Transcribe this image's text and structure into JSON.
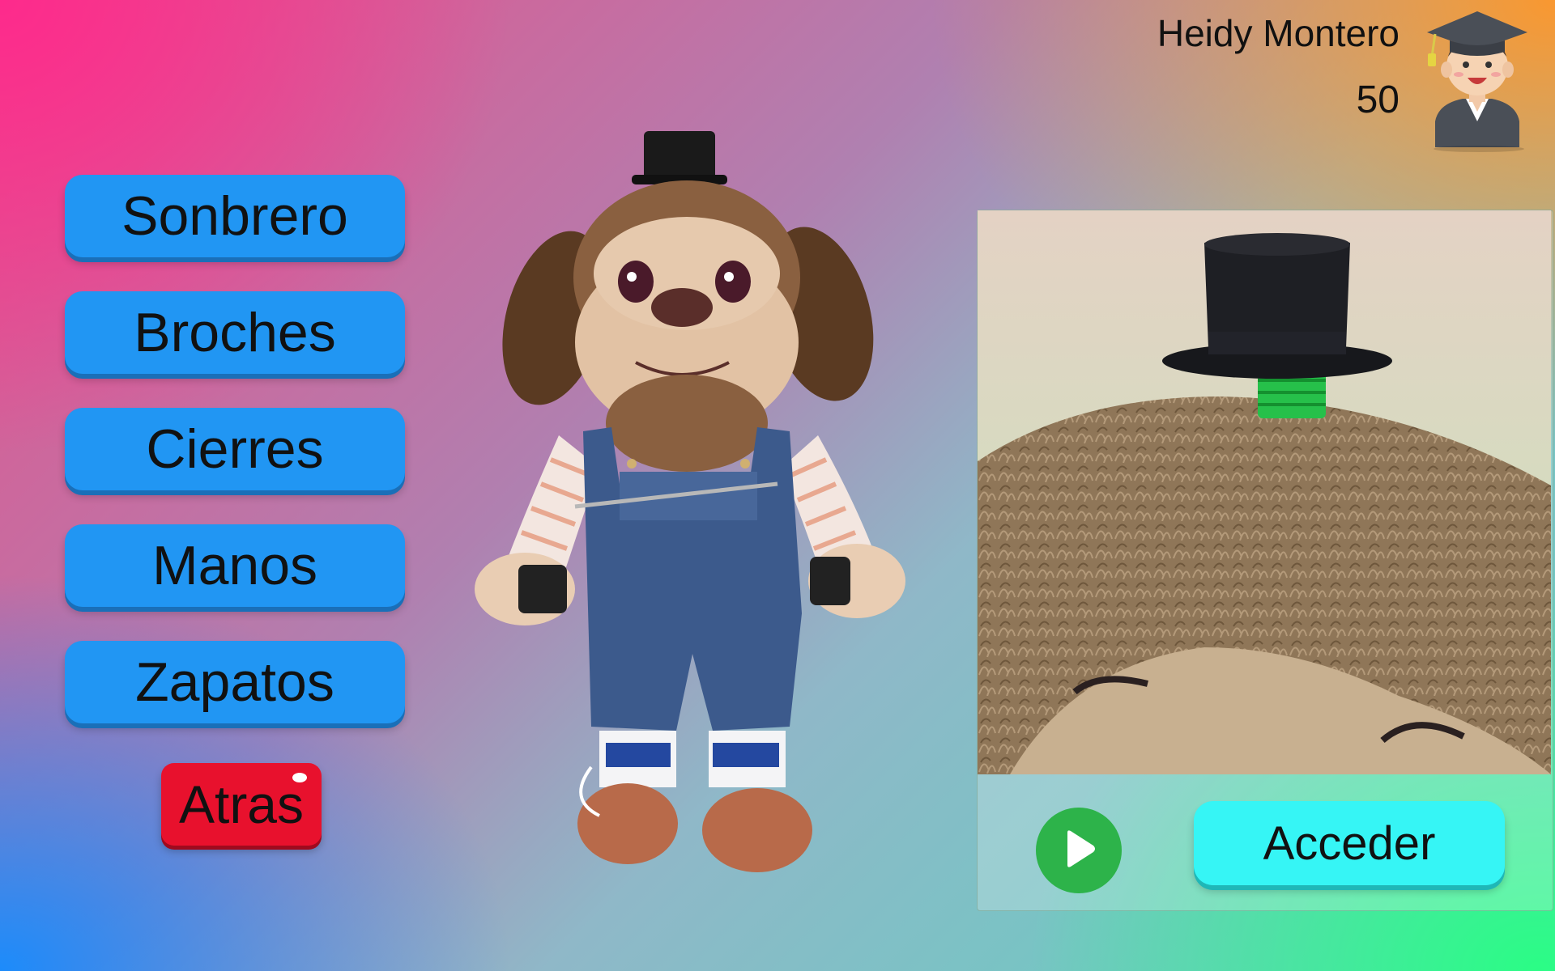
{
  "user": {
    "name": "Heidy Montero",
    "points": "50"
  },
  "menu": {
    "items": [
      {
        "label": "Sonbrero"
      },
      {
        "label": "Broches"
      },
      {
        "label": "Cierres"
      },
      {
        "label": "Manos"
      },
      {
        "label": "Zapatos"
      }
    ]
  },
  "back": {
    "label": "Atras"
  },
  "panel": {
    "access_label": "Acceder"
  },
  "colors": {
    "menu_button": "#2196f3",
    "back_button": "#e8112d",
    "access_button": "#36f5f5",
    "play_button": "#2db34a"
  },
  "icons": {
    "avatar": "graduate-avatar-icon",
    "play": "play-icon"
  }
}
